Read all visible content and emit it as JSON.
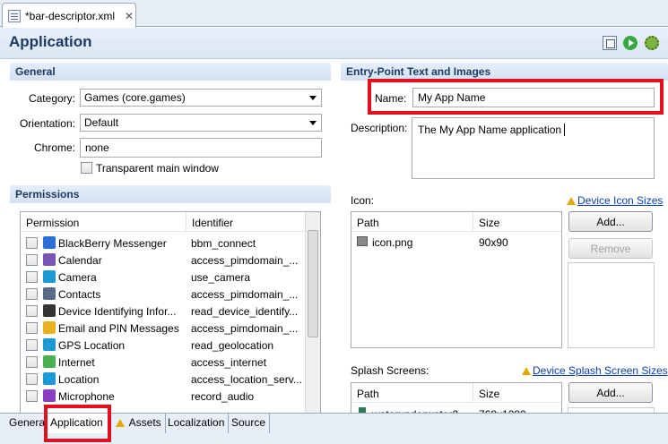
{
  "editor_tab": {
    "title": "*bar-descriptor.xml",
    "icon": "xml-file-icon",
    "close_icon": "close-icon"
  },
  "header": {
    "title": "Application",
    "icons": [
      "package-icon",
      "run-icon",
      "debug-icon"
    ]
  },
  "general": {
    "title": "General",
    "category_label": "Category:",
    "category_value": "Games (core.games)",
    "orientation_label": "Orientation:",
    "orientation_value": "Default",
    "chrome_label": "Chrome:",
    "chrome_value": "none",
    "transparent_label": "Transparent main window"
  },
  "permissions": {
    "title": "Permissions",
    "col_permission": "Permission",
    "col_identifier": "Identifier",
    "rows": [
      {
        "name": "BlackBerry Messenger",
        "id": "bbm_connect",
        "icon": "bbm-icon",
        "color": "#2a6fd6"
      },
      {
        "name": "Calendar",
        "id": "access_pimdomain_...",
        "icon": "calendar-icon",
        "color": "#7a55b5"
      },
      {
        "name": "Camera",
        "id": "use_camera",
        "icon": "camera-icon",
        "color": "#1c9ad6"
      },
      {
        "name": "Contacts",
        "id": "access_pimdomain_...",
        "icon": "contacts-icon",
        "color": "#5a6b8a"
      },
      {
        "name": "Device Identifying Infor...",
        "id": "read_device_identify...",
        "icon": "device-info-icon",
        "color": "#333333"
      },
      {
        "name": "Email and PIN Messages",
        "id": "access_pimdomain_...",
        "icon": "email-icon",
        "color": "#e8b21e"
      },
      {
        "name": "GPS Location",
        "id": "read_geolocation",
        "icon": "gps-icon",
        "color": "#1c9ad6"
      },
      {
        "name": "Internet",
        "id": "access_internet",
        "icon": "internet-icon",
        "color": "#4caf50"
      },
      {
        "name": "Location",
        "id": "access_location_serv...",
        "icon": "location-icon",
        "color": "#1c9ad6"
      },
      {
        "name": "Microphone",
        "id": "record_audio",
        "icon": "microphone-icon",
        "color": "#8a3fc2"
      }
    ]
  },
  "entry_point": {
    "title": "Entry-Point Text and Images",
    "name_label": "Name:",
    "name_value": "My App Name",
    "description_label": "Description:",
    "description_value": "The My App Name application",
    "icon_label": "Icon:",
    "icon_link": "Device Icon Sizes",
    "icon_table": {
      "col_path": "Path",
      "col_size": "Size",
      "rows": [
        {
          "path": "icon.png",
          "size": "90x90"
        }
      ]
    },
    "add_label": "Add...",
    "remove_label": "Remove",
    "splash_label": "Splash Screens:",
    "splash_link": "Device Splash Screen Sizes",
    "splash_table": {
      "col_path": "Path",
      "col_size": "Size",
      "rows": [
        {
          "path": "waterunderwater2...",
          "size": "768x1280"
        }
      ]
    },
    "splash_add_label": "Add..."
  },
  "bottom_tabs": [
    "General",
    "Application",
    "Assets",
    "Localization",
    "Source"
  ],
  "colors": {
    "highlight": "#e0101e",
    "header_text": "#1c3a63",
    "link": "#0a3fb0"
  }
}
